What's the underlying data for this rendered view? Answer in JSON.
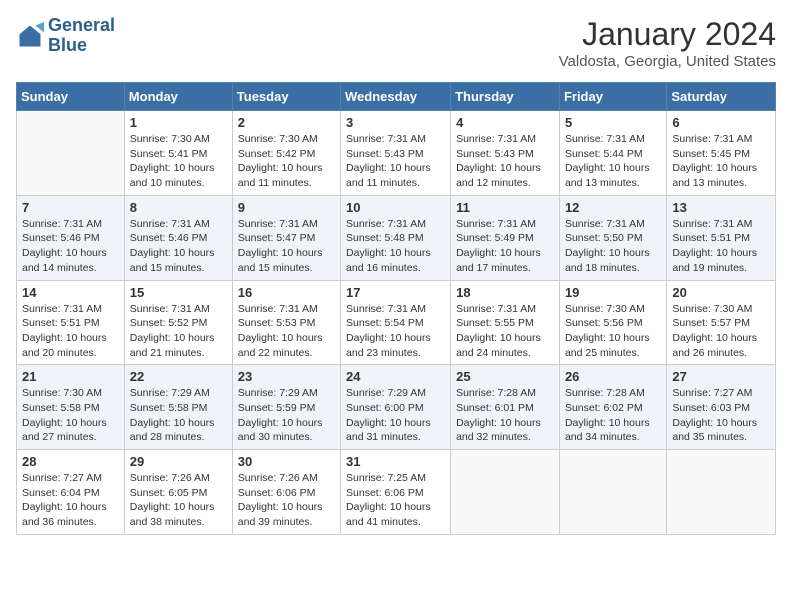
{
  "header": {
    "logo_line1": "General",
    "logo_line2": "Blue",
    "month_title": "January 2024",
    "location": "Valdosta, Georgia, United States"
  },
  "weekdays": [
    "Sunday",
    "Monday",
    "Tuesday",
    "Wednesday",
    "Thursday",
    "Friday",
    "Saturday"
  ],
  "weeks": [
    [
      {
        "day": "",
        "info": ""
      },
      {
        "day": "1",
        "info": "Sunrise: 7:30 AM\nSunset: 5:41 PM\nDaylight: 10 hours\nand 10 minutes."
      },
      {
        "day": "2",
        "info": "Sunrise: 7:30 AM\nSunset: 5:42 PM\nDaylight: 10 hours\nand 11 minutes."
      },
      {
        "day": "3",
        "info": "Sunrise: 7:31 AM\nSunset: 5:43 PM\nDaylight: 10 hours\nand 11 minutes."
      },
      {
        "day": "4",
        "info": "Sunrise: 7:31 AM\nSunset: 5:43 PM\nDaylight: 10 hours\nand 12 minutes."
      },
      {
        "day": "5",
        "info": "Sunrise: 7:31 AM\nSunset: 5:44 PM\nDaylight: 10 hours\nand 13 minutes."
      },
      {
        "day": "6",
        "info": "Sunrise: 7:31 AM\nSunset: 5:45 PM\nDaylight: 10 hours\nand 13 minutes."
      }
    ],
    [
      {
        "day": "7",
        "info": "Sunrise: 7:31 AM\nSunset: 5:46 PM\nDaylight: 10 hours\nand 14 minutes."
      },
      {
        "day": "8",
        "info": "Sunrise: 7:31 AM\nSunset: 5:46 PM\nDaylight: 10 hours\nand 15 minutes."
      },
      {
        "day": "9",
        "info": "Sunrise: 7:31 AM\nSunset: 5:47 PM\nDaylight: 10 hours\nand 15 minutes."
      },
      {
        "day": "10",
        "info": "Sunrise: 7:31 AM\nSunset: 5:48 PM\nDaylight: 10 hours\nand 16 minutes."
      },
      {
        "day": "11",
        "info": "Sunrise: 7:31 AM\nSunset: 5:49 PM\nDaylight: 10 hours\nand 17 minutes."
      },
      {
        "day": "12",
        "info": "Sunrise: 7:31 AM\nSunset: 5:50 PM\nDaylight: 10 hours\nand 18 minutes."
      },
      {
        "day": "13",
        "info": "Sunrise: 7:31 AM\nSunset: 5:51 PM\nDaylight: 10 hours\nand 19 minutes."
      }
    ],
    [
      {
        "day": "14",
        "info": "Sunrise: 7:31 AM\nSunset: 5:51 PM\nDaylight: 10 hours\nand 20 minutes."
      },
      {
        "day": "15",
        "info": "Sunrise: 7:31 AM\nSunset: 5:52 PM\nDaylight: 10 hours\nand 21 minutes."
      },
      {
        "day": "16",
        "info": "Sunrise: 7:31 AM\nSunset: 5:53 PM\nDaylight: 10 hours\nand 22 minutes."
      },
      {
        "day": "17",
        "info": "Sunrise: 7:31 AM\nSunset: 5:54 PM\nDaylight: 10 hours\nand 23 minutes."
      },
      {
        "day": "18",
        "info": "Sunrise: 7:31 AM\nSunset: 5:55 PM\nDaylight: 10 hours\nand 24 minutes."
      },
      {
        "day": "19",
        "info": "Sunrise: 7:30 AM\nSunset: 5:56 PM\nDaylight: 10 hours\nand 25 minutes."
      },
      {
        "day": "20",
        "info": "Sunrise: 7:30 AM\nSunset: 5:57 PM\nDaylight: 10 hours\nand 26 minutes."
      }
    ],
    [
      {
        "day": "21",
        "info": "Sunrise: 7:30 AM\nSunset: 5:58 PM\nDaylight: 10 hours\nand 27 minutes."
      },
      {
        "day": "22",
        "info": "Sunrise: 7:29 AM\nSunset: 5:58 PM\nDaylight: 10 hours\nand 28 minutes."
      },
      {
        "day": "23",
        "info": "Sunrise: 7:29 AM\nSunset: 5:59 PM\nDaylight: 10 hours\nand 30 minutes."
      },
      {
        "day": "24",
        "info": "Sunrise: 7:29 AM\nSunset: 6:00 PM\nDaylight: 10 hours\nand 31 minutes."
      },
      {
        "day": "25",
        "info": "Sunrise: 7:28 AM\nSunset: 6:01 PM\nDaylight: 10 hours\nand 32 minutes."
      },
      {
        "day": "26",
        "info": "Sunrise: 7:28 AM\nSunset: 6:02 PM\nDaylight: 10 hours\nand 34 minutes."
      },
      {
        "day": "27",
        "info": "Sunrise: 7:27 AM\nSunset: 6:03 PM\nDaylight: 10 hours\nand 35 minutes."
      }
    ],
    [
      {
        "day": "28",
        "info": "Sunrise: 7:27 AM\nSunset: 6:04 PM\nDaylight: 10 hours\nand 36 minutes."
      },
      {
        "day": "29",
        "info": "Sunrise: 7:26 AM\nSunset: 6:05 PM\nDaylight: 10 hours\nand 38 minutes."
      },
      {
        "day": "30",
        "info": "Sunrise: 7:26 AM\nSunset: 6:06 PM\nDaylight: 10 hours\nand 39 minutes."
      },
      {
        "day": "31",
        "info": "Sunrise: 7:25 AM\nSunset: 6:06 PM\nDaylight: 10 hours\nand 41 minutes."
      },
      {
        "day": "",
        "info": ""
      },
      {
        "day": "",
        "info": ""
      },
      {
        "day": "",
        "info": ""
      }
    ]
  ]
}
